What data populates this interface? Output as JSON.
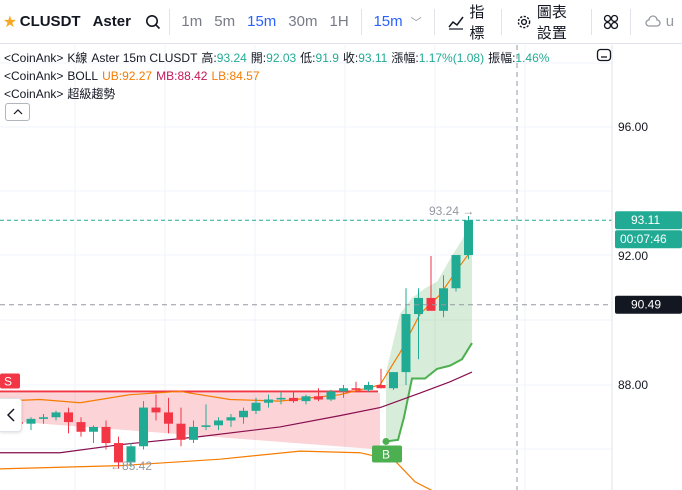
{
  "toolbar": {
    "symbol": "CLUSDT",
    "exchange": "Aster",
    "intervals": [
      "1m",
      "5m",
      "15m",
      "30m",
      "1H"
    ],
    "active_interval": "15m",
    "interval_dropdown": "15m",
    "indicators_label": "指標",
    "settings_label": "圖表設置",
    "cut_label": "u"
  },
  "legend": {
    "kline": {
      "source": "<CoinAnk>",
      "name": "K線",
      "desc": "Aster 15m CLUSDT",
      "high_label": "高:",
      "high": "93.24",
      "open_label": "開:",
      "open": "92.03",
      "low_label": "低:",
      "low": "91.9",
      "close_label": "收:",
      "close": "93.11",
      "change_label": "漲幅:",
      "change": "1.17%(1.08)",
      "amp_label": "振幅:",
      "amp": "1.46%"
    },
    "boll": {
      "source": "<CoinAnk>",
      "name": "BOLL",
      "ub_label": "UB:",
      "ub": "92.27",
      "mb_label": "MB:",
      "mb": "88.42",
      "lb_label": "LB:",
      "lb": "84.57"
    },
    "supertrend": {
      "source": "<CoinAnk>",
      "name": "超級趨勢"
    }
  },
  "price_axis": {
    "labels": [
      "96.00",
      "92.00",
      "88.00"
    ],
    "last_price": "93.11",
    "countdown": "00:07:46",
    "crosshair_price": "90.49"
  },
  "annotations": {
    "high_marker": "93.24",
    "low_marker": "85.42",
    "sell_signal": "S",
    "buy_signal": "B"
  },
  "colors": {
    "up": "#22ab94",
    "down": "#f23645",
    "boll_mb": "#f57c00",
    "boll_ub": "#880e4f",
    "supertrend_up": "#4caf50",
    "supertrend_down": "#f23645",
    "accent": "#2962ff"
  }
}
